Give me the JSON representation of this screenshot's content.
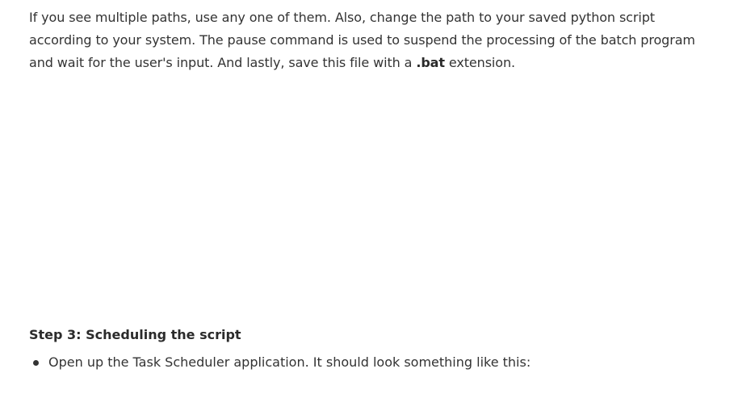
{
  "intro": {
    "text_before_bold": "If you see multiple paths, use any one of them. Also, change the path to your saved python script according to your system. The pause command is used to suspend the processing of the batch program and wait for the user's input. And lastly, save this file with a ",
    "bold_text": ".bat",
    "text_after_bold": " extension."
  },
  "step3": {
    "heading": "Step 3: Scheduling the script",
    "bullets": [
      "Open up the Task Scheduler application. It should look something like this:"
    ]
  }
}
